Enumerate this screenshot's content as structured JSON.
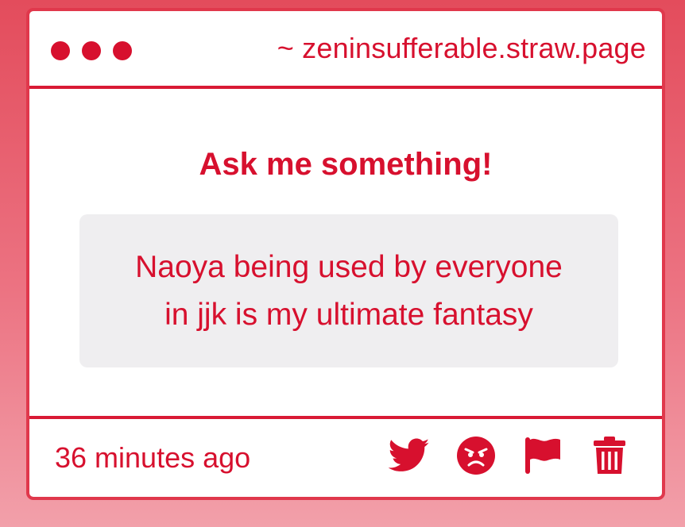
{
  "window": {
    "url": "~ zeninsufferable.straw.page"
  },
  "main": {
    "heading": "Ask me something!",
    "question_line1": "Naoya being used by everyone",
    "question_line2": "in jjk is my ultimate fantasy"
  },
  "footer": {
    "timestamp": "36 minutes ago",
    "actions": [
      {
        "icon": "twitter-icon"
      },
      {
        "icon": "angry-face-icon"
      },
      {
        "icon": "flag-icon"
      },
      {
        "icon": "trash-icon"
      }
    ]
  },
  "colors": {
    "accent": "#d7102e",
    "border": "#e0384c",
    "question_bg": "#efeef0",
    "background_top": "#e34c5c",
    "background_bottom": "#f2a0aa"
  }
}
